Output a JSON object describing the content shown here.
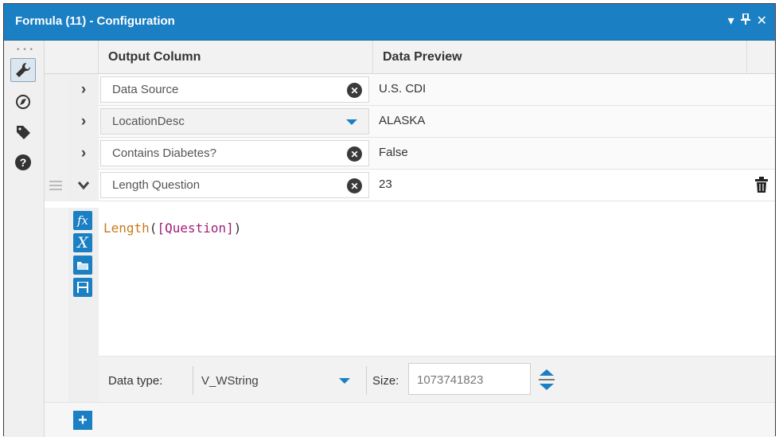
{
  "window": {
    "title": "Formula (11) - Configuration"
  },
  "title_controls": {
    "dropdown": "▾",
    "pin": "⊥",
    "close": "✕"
  },
  "left_toolbar": {
    "tools": [
      "wrench-icon",
      "compass-icon",
      "tag-icon",
      "help-icon"
    ],
    "active": "wrench-icon"
  },
  "grid": {
    "headers": {
      "output_column": "Output Column",
      "data_preview": "Data Preview"
    },
    "rows": [
      {
        "output": "Data Source",
        "preview": "U.S. CDI",
        "control": "clear",
        "expanded": false
      },
      {
        "output": "LocationDesc",
        "preview": "ALASKA",
        "control": "dropdown",
        "expanded": false
      },
      {
        "output": "Contains Diabetes?",
        "preview": "False",
        "control": "clear",
        "expanded": false
      },
      {
        "output": "Length Question",
        "preview": "23",
        "control": "clear",
        "expanded": true
      }
    ]
  },
  "editor": {
    "expression_fn": "Length",
    "expression_open": "(",
    "expression_field": "[Question]",
    "expression_close": ")",
    "buttons": [
      "fx-icon",
      "variable-icon",
      "open-folder-icon",
      "save-icon"
    ]
  },
  "type_bar": {
    "data_type_label": "Data type:",
    "data_type_value": "V_WString",
    "size_label": "Size:",
    "size_value": "1073741823"
  },
  "colors": {
    "accent": "#1b7fc4",
    "function": "#c87a1a",
    "field": "#a31d78"
  }
}
